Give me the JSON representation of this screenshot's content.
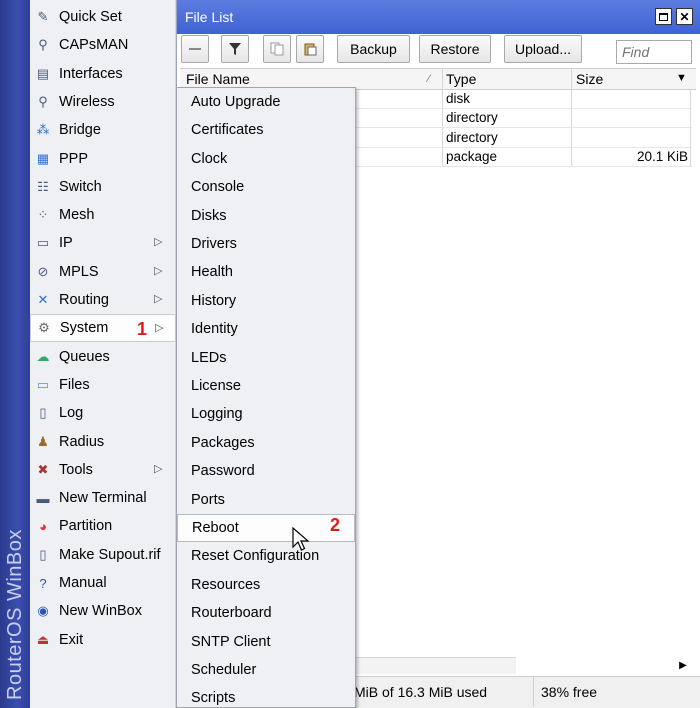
{
  "brand": "RouterOS WinBox",
  "main_menu": [
    {
      "label": "Quick Set",
      "icon": "wand-icon",
      "has_submenu": false
    },
    {
      "label": "CAPsMAN",
      "icon": "antenna-icon",
      "has_submenu": false
    },
    {
      "label": "Interfaces",
      "icon": "interface-icon",
      "has_submenu": false
    },
    {
      "label": "Wireless",
      "icon": "antenna-icon",
      "has_submenu": false
    },
    {
      "label": "Bridge",
      "icon": "bridge-icon",
      "has_submenu": false
    },
    {
      "label": "PPP",
      "icon": "ppp-icon",
      "has_submenu": false
    },
    {
      "label": "Switch",
      "icon": "switch-icon",
      "has_submenu": false
    },
    {
      "label": "Mesh",
      "icon": "mesh-icon",
      "has_submenu": false
    },
    {
      "label": "IP",
      "icon": "ip-icon",
      "has_submenu": true
    },
    {
      "label": "MPLS",
      "icon": "mpls-icon",
      "has_submenu": true
    },
    {
      "label": "Routing",
      "icon": "routing-icon",
      "has_submenu": true
    },
    {
      "label": "System",
      "icon": "gear-icon",
      "has_submenu": true,
      "selected": true
    },
    {
      "label": "Queues",
      "icon": "queues-icon",
      "has_submenu": false
    },
    {
      "label": "Files",
      "icon": "folder-icon",
      "has_submenu": false
    },
    {
      "label": "Log",
      "icon": "log-icon",
      "has_submenu": false
    },
    {
      "label": "Radius",
      "icon": "radius-icon",
      "has_submenu": false
    },
    {
      "label": "Tools",
      "icon": "tools-icon",
      "has_submenu": true
    },
    {
      "label": "New Terminal",
      "icon": "terminal-icon",
      "has_submenu": false
    },
    {
      "label": "Partition",
      "icon": "partition-icon",
      "has_submenu": false
    },
    {
      "label": "Make Supout.rif",
      "icon": "document-icon",
      "has_submenu": false
    },
    {
      "label": "Manual",
      "icon": "help-icon",
      "has_submenu": false
    },
    {
      "label": "New WinBox",
      "icon": "globe-icon",
      "has_submenu": false
    },
    {
      "label": "Exit",
      "icon": "exit-icon",
      "has_submenu": false
    }
  ],
  "markers": {
    "system": "1",
    "reboot": "2"
  },
  "system_submenu": [
    "Auto Upgrade",
    "Certificates",
    "Clock",
    "Console",
    "Disks",
    "Drivers",
    "Health",
    "History",
    "Identity",
    "LEDs",
    "License",
    "Logging",
    "Packages",
    "Password",
    "Ports",
    "Reboot",
    "Reset Configuration",
    "Resources",
    "Routerboard",
    "SNTP Client",
    "Scheduler",
    "Scripts"
  ],
  "file_window": {
    "title": "File List",
    "toolbar": {
      "backup": "Backup",
      "restore": "Restore",
      "upload": "Upload...",
      "find_placeholder": "Find"
    },
    "columns": [
      "File Name",
      "Type",
      "Size"
    ],
    "rows": [
      {
        "name": "",
        "type": "disk",
        "size": ""
      },
      {
        "name": "",
        "type": "directory",
        "size": ""
      },
      {
        "name": "",
        "type": "directory",
        "size": ""
      },
      {
        "name": "",
        "type": "package",
        "size": "20.1 KiB"
      }
    ],
    "status": {
      "usage": "MiB of 16.3 MiB used",
      "free": "38% free"
    }
  },
  "colors": {
    "title_bar": "#4a6cd9",
    "brand_strip": "#3447a3",
    "marker": "#e01b1b"
  }
}
